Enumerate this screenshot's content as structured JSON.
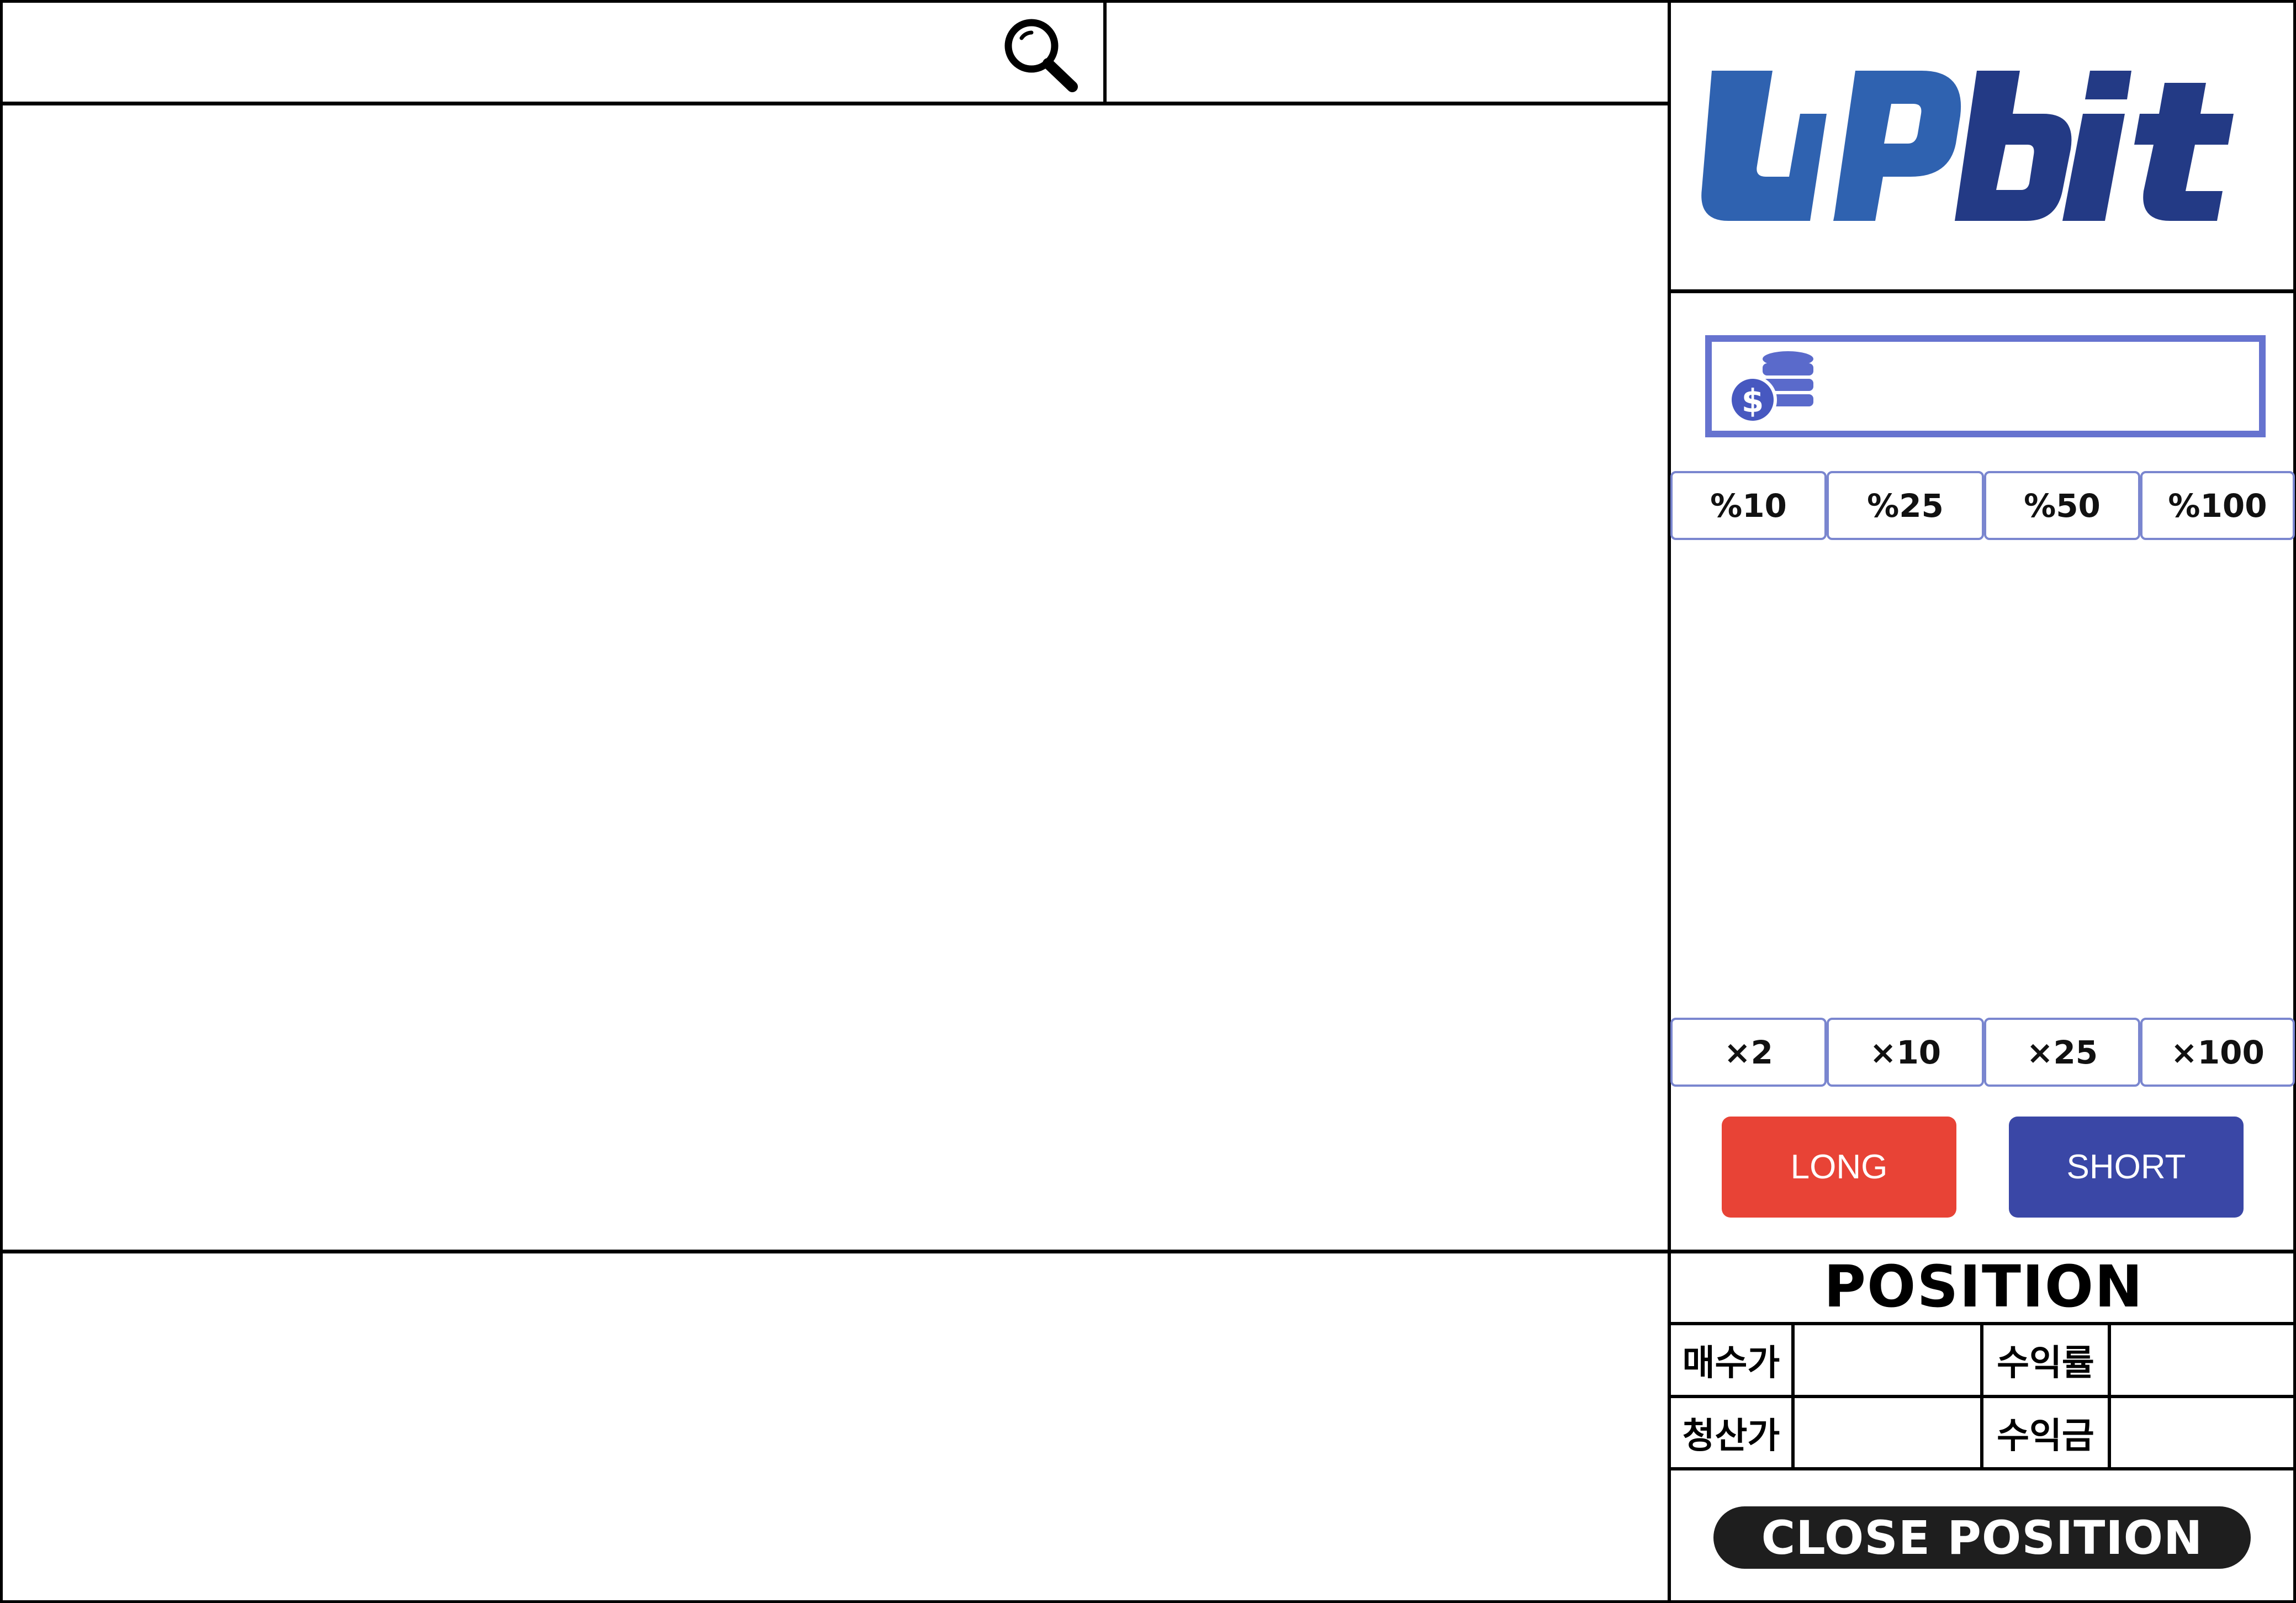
{
  "search": {
    "placeholder": "",
    "value": ""
  },
  "brand": {
    "logo_text": "UPbit",
    "color_light": "#2f62b0",
    "color_dark": "#233a85"
  },
  "order": {
    "amount_placeholder": "",
    "percent_options": [
      "%10",
      "%25",
      "%50",
      "%100"
    ],
    "leverage_options": [
      "×2",
      "×10",
      "×25",
      "×100"
    ],
    "long_label": "LONG",
    "short_label": "SHORT",
    "long_color": "#e84336",
    "short_color": "#3a47a6"
  },
  "position": {
    "title": "POSITION",
    "entry_price_label": "매수가",
    "entry_price_value": "",
    "return_rate_label": "수익률",
    "return_rate_value": "",
    "liquidation_price_label": "청산가",
    "liquidation_price_value": "",
    "profit_label": "수익금",
    "profit_value": "",
    "close_label": "CLOSE POSITION"
  }
}
